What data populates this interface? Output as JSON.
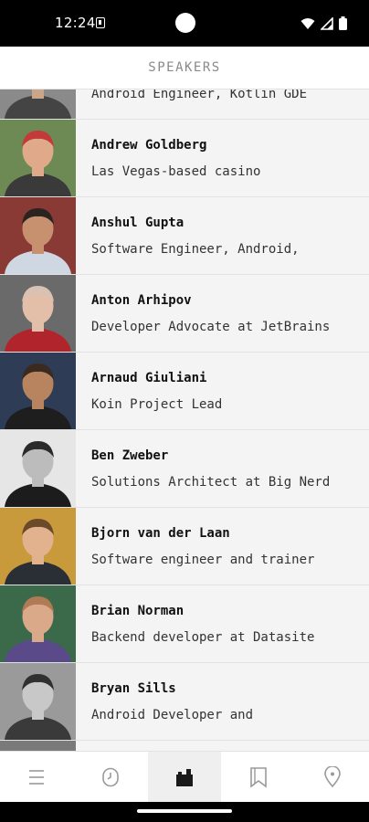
{
  "status_bar": {
    "time": "12:24"
  },
  "app_bar": {
    "title": "SPEAKERS"
  },
  "speakers": [
    {
      "name": "",
      "title": "Android Engineer, Kotlin GDE",
      "skin": "#c9a58a",
      "hair": "#5a4030",
      "bg": "#8a8a8a",
      "shirt": "#444444"
    },
    {
      "name": "Andrew Goldberg",
      "title": "Las Vegas-based casino",
      "skin": "#e0a98a",
      "hair": "#c23a3a",
      "bg": "#6d8a55",
      "shirt": "#3a3a3a"
    },
    {
      "name": "Anshul Gupta",
      "title": "Software Engineer, Android,",
      "skin": "#c7906e",
      "hair": "#2b2320",
      "bg": "#8a3a35",
      "shirt": "#cfd8e2"
    },
    {
      "name": "Anton Arhipov",
      "title": "Developer Advocate at JetBrains",
      "skin": "#e3bfaa",
      "hair": "#d9c2b3",
      "bg": "#6a6a6a",
      "shirt": "#b2242c"
    },
    {
      "name": "Arnaud Giuliani",
      "title": "Koin Project Lead",
      "skin": "#b88460",
      "hair": "#3a2a20",
      "bg": "#2e3c55",
      "shirt": "#1e1e1e"
    },
    {
      "name": "Ben Zweber",
      "title": "Solutions Architect at Big Nerd",
      "skin": "#bcbcbc",
      "hair": "#2a2a2a",
      "bg": "#e6e6e6",
      "shirt": "#1c1c1c"
    },
    {
      "name": "Bjorn van der Laan",
      "title": "Software engineer and trainer",
      "skin": "#e2b28e",
      "hair": "#6b4a2a",
      "bg": "#c99a3c",
      "shirt": "#2a2f36"
    },
    {
      "name": "Brian Norman",
      "title": "Backend developer at Datasite",
      "skin": "#d9a98a",
      "hair": "#b07a55",
      "bg": "#3a6a4a",
      "shirt": "#5a4a8a"
    },
    {
      "name": "Bryan Sills",
      "title": "Android Developer and",
      "skin": "#c8c8c8",
      "hair": "#303030",
      "bg": "#9a9a9a",
      "shirt": "#3a3a3a"
    },
    {
      "name": "",
      "title": "",
      "skin": "#c8a080",
      "hair": "#4a3a2a",
      "bg": "#7a7a7a",
      "shirt": "#333333"
    }
  ],
  "nav": {
    "items": [
      {
        "icon": "menu-icon",
        "active": false
      },
      {
        "icon": "clock-icon",
        "active": false
      },
      {
        "icon": "speakers-icon",
        "active": true
      },
      {
        "icon": "bookmark-icon",
        "active": false
      },
      {
        "icon": "location-pin-icon",
        "active": false
      }
    ]
  },
  "colors": {
    "background": "#f4f4f4",
    "divider": "#e2e2e2",
    "text": "#111111"
  }
}
